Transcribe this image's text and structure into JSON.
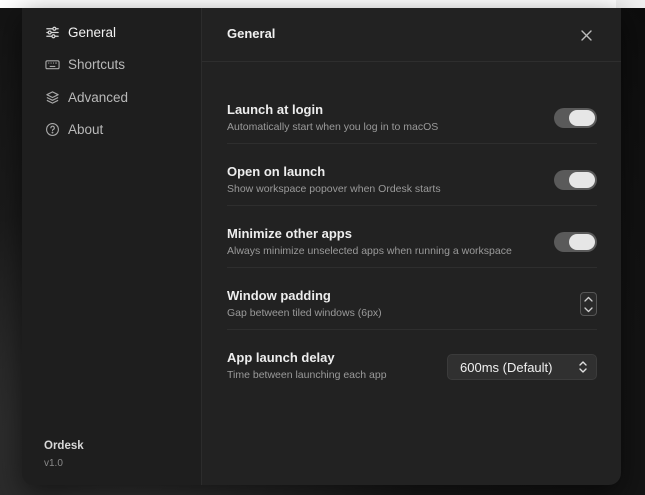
{
  "app": {
    "name": "Ordesk",
    "version": "v1.0"
  },
  "sidebar": {
    "items": [
      {
        "label": "General",
        "icon": "sliders-icon",
        "active": true
      },
      {
        "label": "Shortcuts",
        "icon": "keyboard-icon",
        "active": false
      },
      {
        "label": "Advanced",
        "icon": "layers-icon",
        "active": false
      },
      {
        "label": "About",
        "icon": "question-circle-icon",
        "active": false
      }
    ]
  },
  "header": {
    "title": "General",
    "close_icon": "close-icon"
  },
  "settings": [
    {
      "title": "Launch at login",
      "description": "Automatically start when you log in to macOS",
      "control": "toggle",
      "enabled": true
    },
    {
      "title": "Open on launch",
      "description": "Show workspace popover when Ordesk starts",
      "control": "toggle",
      "enabled": true
    },
    {
      "title": "Minimize other apps",
      "description": "Always minimize unselected apps when running a workspace",
      "control": "toggle",
      "enabled": true
    },
    {
      "title": "Window padding",
      "description": "Gap between tiled windows (6px)",
      "control": "stepper"
    },
    {
      "title": "App launch delay",
      "description": "Time between launching each app",
      "control": "select",
      "value": "600ms (Default)"
    }
  ],
  "colors": {
    "window_bg": "#222222",
    "sidebar_bg": "#1e1e1e",
    "toggle_on": "#5a5a5a",
    "knob": "#e6e6e6"
  }
}
